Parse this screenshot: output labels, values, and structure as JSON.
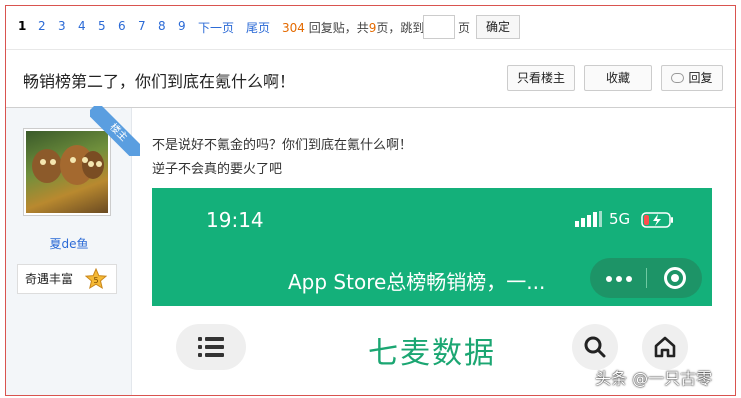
{
  "pager": {
    "current_page": "1",
    "pages": [
      "2",
      "3",
      "4",
      "5",
      "6",
      "7",
      "8",
      "9"
    ],
    "next_label": "下一页",
    "last_label": "尾页",
    "reply_count": "304",
    "reply_text": "回复贴，共",
    "total_pages": "9",
    "pages_suffix": "页，跳到",
    "page_unit": "页",
    "page_input_value": "",
    "go_label": "确定"
  },
  "thread": {
    "title": "畅销榜第二了，你们到底在氪什么啊！",
    "only_author_label": "只看楼主",
    "favorite_label": "收藏",
    "reply_label": "回复"
  },
  "author": {
    "ribbon_label": "楼主",
    "username": "夏de鱼",
    "medal_label": "奇遇丰富",
    "medal_level": "5"
  },
  "post": {
    "line1": "不是说好不氪金的吗？你们到底在氪什么啊！",
    "line2": "逆子不会真的要火了吧"
  },
  "screenshot": {
    "time": "19:14",
    "network": "5G",
    "headline": "App Store总榜畅销榜，一...",
    "brand": "七麦数据"
  },
  "watermark": "头条 @一只古零",
  "colors": {
    "accent_blue": "#2b6ad6",
    "reply_count_orange": "#e46a00",
    "green": "#14b07a",
    "frame_red": "#d9534f"
  }
}
